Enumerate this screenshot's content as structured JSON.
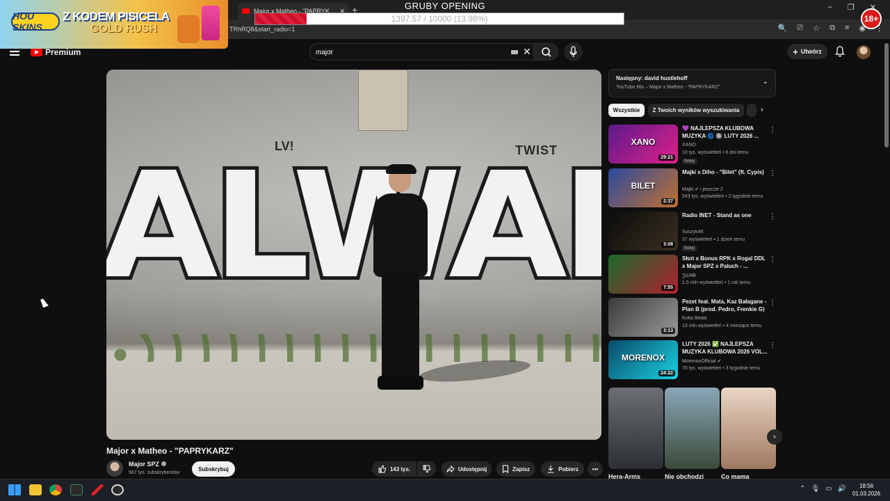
{
  "browser": {
    "tab_title": "Major x Matheo - \"PAPRYK...",
    "new_tab": "+",
    "url": "TRhRQ8&start_radio=1",
    "window_controls": [
      "–",
      "❐",
      "✕"
    ]
  },
  "overlays": {
    "promo_logo": "HOU SKINS",
    "promo_code": "Z KODEM PISICELA",
    "promo_sub": "GOLD RUSH",
    "goal_title": "GRUBY OPENING",
    "goal_text": "1397.57 / 10000 (13.98%)",
    "goal_progress": 0.1398,
    "age_badge": "18+"
  },
  "header": {
    "brand": "Premium",
    "search_value": "major",
    "create_label": "Utwórz"
  },
  "video": {
    "title": "Major x Matheo - \"PAPRYKARZ\"",
    "graffiti_text": "ALWAN",
    "tag_left": "LV!",
    "tag_right": "TWIST",
    "channel_name": "Major SPZ",
    "channel_subs": "567 tys. subskrybentów",
    "subscribe_label": "Subskrybuj",
    "likes": "143 tys.",
    "share_label": "Udostępnij",
    "save_label": "Zapisz",
    "download_label": "Pobierz"
  },
  "sidebar": {
    "next_label": "Następny: david hustlehoff",
    "next_sub": "YouTube Mix – Major x Matheo - \"PAPRYKARZ\"",
    "chips": [
      "Wszystkie",
      "Z Twoich wyników wyszukiwania"
    ],
    "videos": [
      {
        "title": "💜 NAJLEPSZA KLUBOWA MUZYKA 🌀 🔘 LUTY 2026 ...",
        "channel": "XANO",
        "meta": "10 tys. wyświetleń • 6 dni temu",
        "badge": "Nowy",
        "duration": "29:21",
        "thumb_text": "XANO",
        "colors": [
          "#5b1a8a",
          "#e0208a"
        ]
      },
      {
        "title": "Majki x Diho - \"Bilet\" (ft. Cypis)",
        "channel": "Majki ✔ i jeszcze 2",
        "meta": "543 tys. wyświetleń • 2 tygodnie temu",
        "badge": "",
        "duration": "2:37",
        "thumb_text": "BILET",
        "colors": [
          "#2b4aa0",
          "#c07030"
        ]
      },
      {
        "title": "Radio INET - Stand as one",
        "channel": "Suszyk4K",
        "meta": "37 wyświetleń • 1 dzień temu",
        "badge": "Nowy",
        "duration": "3:08",
        "thumb_text": "",
        "colors": [
          "#0c0c0c",
          "#3a3020"
        ]
      },
      {
        "title": "Słoń x Bonus RPK x Rogal DDL x Major SPZ x Paluch - ...",
        "channel": "ƷΔЯ✠",
        "meta": "1,5 mln wyświetleń • 1 rok temu",
        "badge": "",
        "duration": "7:55",
        "thumb_text": "",
        "colors": [
          "#1a6a2a",
          "#b02030"
        ]
      },
      {
        "title": "Pezet feat. Mata, Kaz Bałagane - Plan B (prod. Pedro, Frenkie G)",
        "channel": "Koka Beats",
        "meta": "13 mln wyświetleń • 4 miesiące temu",
        "badge": "",
        "duration": "3:13",
        "thumb_text": "",
        "colors": [
          "#3a3a3a",
          "#9a9a9a"
        ]
      },
      {
        "title": "LUTY 2026 ✅ NAJLEPSZA MUZYKA KLUBOWA 2026 VOL...",
        "channel": "MorenoxOfficial ✔",
        "meta": "70 tys. wyświetleń • 3 tygodnie temu",
        "badge": "",
        "duration": "24:22",
        "thumb_text": "MORENOX",
        "colors": [
          "#0a4a6a",
          "#1ad0e0"
        ]
      }
    ],
    "shorts": [
      {
        "title": "Hera-Arms",
        "colors": [
          "#6b6f74",
          "#2c2f33"
        ]
      },
      {
        "title": "Nie obchodzi",
        "colors": [
          "#8aa7b8",
          "#3a4a3a"
        ]
      },
      {
        "title": "Co mama",
        "colors": [
          "#e8d6c4",
          "#a07860"
        ]
      }
    ],
    "shorts_next": "›"
  },
  "taskbar": {
    "time": "18:56",
    "date": "01.03.2026",
    "tray": [
      "⌃",
      "🎙",
      "▭",
      "🔊"
    ]
  }
}
